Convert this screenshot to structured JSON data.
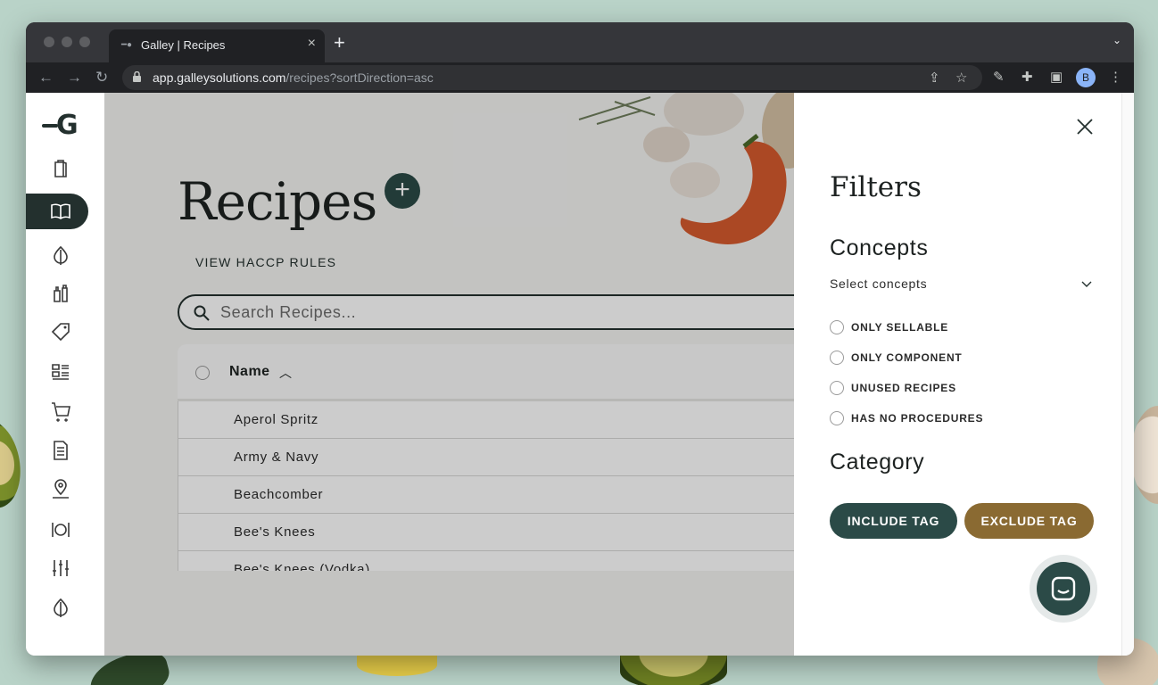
{
  "browser": {
    "tab_title": "Galley | Recipes",
    "url_host": "app.galleysolutions.com",
    "url_path": "/recipes?sortDirection=asc",
    "profile_initial": "B"
  },
  "page": {
    "title": "Recipes",
    "add_symbol": "+",
    "haccp_link": "VIEW HACCP RULES",
    "search_placeholder": "Search Recipes..."
  },
  "table": {
    "column_name": "Name",
    "rows": [
      "Aperol Spritz",
      "Army & Navy",
      "Beachcomber",
      "Bee's Knees",
      "Bee's Knees (Vodka)"
    ]
  },
  "filters": {
    "title": "Filters",
    "concepts_heading": "Concepts",
    "concepts_select": "Select concepts",
    "options": [
      "ONLY SELLABLE",
      "ONLY COMPONENT",
      "UNUSED RECIPES",
      "HAS NO PROCEDURES"
    ],
    "category_heading": "Category",
    "include_tag": "INCLUDE TAG",
    "exclude_tag": "EXCLUDE TAG"
  },
  "colors": {
    "brand_dark": "#2b4a47",
    "exclude_brown": "#8a6a32",
    "background_mint": "#b9d3c8"
  },
  "sidebar": {
    "icons": [
      "logo-g",
      "book-stack-icon",
      "recipe-book-icon",
      "onion-icon",
      "bottles-icon",
      "tag-icon",
      "checklist-icon",
      "cart-icon",
      "document-icon",
      "location-icon",
      "dining-icon",
      "sliders-icon",
      "onion-icon"
    ]
  }
}
